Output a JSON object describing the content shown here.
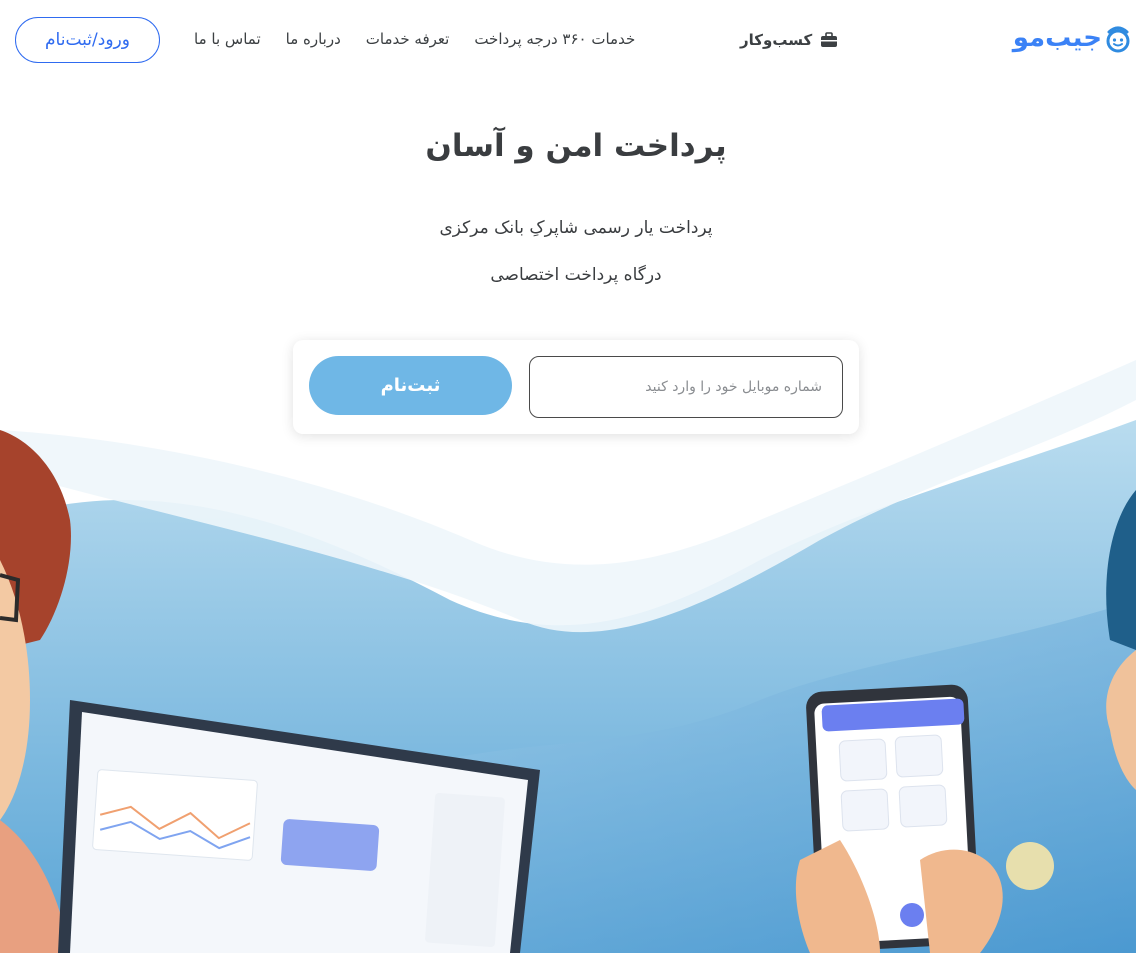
{
  "header": {
    "logo_text": "جیب‌مو",
    "business_label": "کسب‌وکار",
    "nav_items": [
      {
        "label": "خدمات ۳۶۰ درجه پرداخت"
      },
      {
        "label": "تعرفه خدمات"
      },
      {
        "label": "درباره ما"
      },
      {
        "label": "تماس با ما"
      }
    ],
    "login_label": "ورود/ثبت‌نام"
  },
  "hero": {
    "title": "پرداخت امن و آسان",
    "subtitle_1": "پرداخت یار رسمی شاپرکِ بانک مرکزی",
    "subtitle_2": "درگاه پرداخت اختصاصی"
  },
  "signup": {
    "phone_placeholder": "شماره موبایل خود را وارد کنید",
    "phone_value": "",
    "button_label": "ثبت‌نام"
  },
  "colors": {
    "brand_blue": "#3b82f6",
    "signup_button": "#6fb7e6",
    "login_border": "#2f6bf0",
    "illustration_sky": "#8ec5e6"
  },
  "icons": {
    "logo": "wallet-logo-icon",
    "business": "briefcase-icon"
  }
}
